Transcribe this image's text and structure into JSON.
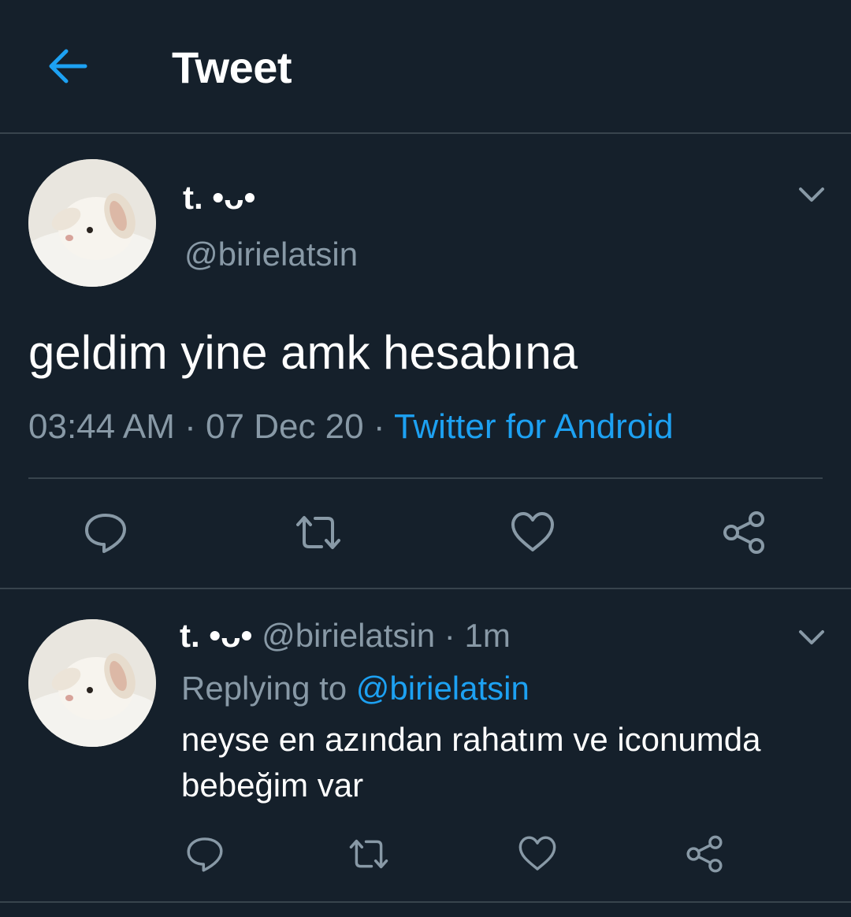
{
  "header": {
    "title": "Tweet"
  },
  "tweet": {
    "display_name": "t. •ᴗ•",
    "handle": "@birielatsin",
    "text": "geldim yine amk hesabına",
    "time": "03:44 AM",
    "dot1": "·",
    "date": "07 Dec 20",
    "dot2": "·",
    "source": "Twitter for Android"
  },
  "reply": {
    "display_name": "t. •ᴗ•",
    "handle": "@birielatsin",
    "dot": "·",
    "age": "1m",
    "replying_label": "Replying to",
    "replying_to": "@birielatsin",
    "text": "neyse en azından rahatım ve iconumda bebeğim var"
  },
  "colors": {
    "background": "#15202b",
    "accent": "#1da1f2",
    "muted": "#8899a6",
    "divider": "#38444d"
  },
  "icons": [
    "back-arrow-icon",
    "chevron-down-icon",
    "reply-icon",
    "retweet-icon",
    "like-icon",
    "share-icon"
  ]
}
